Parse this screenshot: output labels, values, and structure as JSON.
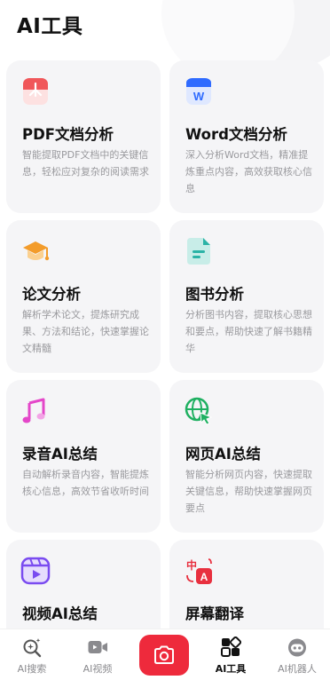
{
  "page": {
    "title": "AI工具"
  },
  "tools": [
    {
      "id": "pdf",
      "title": "PDF文档分析",
      "desc": "智能提取PDF文档中的关键信息，轻松应对复杂的阅读需求",
      "icon": "pdf-file-icon",
      "color": "#f0575a"
    },
    {
      "id": "word",
      "title": "Word文档分析",
      "desc": "深入分析Word文档，精准提炼重点内容，高效获取核心信息",
      "icon": "word-file-icon",
      "color": "#2f6bff"
    },
    {
      "id": "paper",
      "title": "论文分析",
      "desc": "解析学术论文，提炼研究成果、方法和结论，快速掌握论文精髓",
      "icon": "graduation-cap-icon",
      "color": "#f39c2b"
    },
    {
      "id": "book",
      "title": "图书分析",
      "desc": "分析图书内容，提取核心思想和要点，帮助快速了解书籍精华",
      "icon": "book-doc-icon",
      "color": "#2bb3a6"
    },
    {
      "id": "audio",
      "title": "录音AI总结",
      "desc": "自动解析录音内容，智能提炼核心信息，高效节省收听时间",
      "icon": "music-note-icon",
      "color": "#e447c9"
    },
    {
      "id": "web",
      "title": "网页AI总结",
      "desc": "智能分析网页内容，快速提取关键信息，帮助快速掌握网页要点",
      "icon": "globe-cursor-icon",
      "color": "#1fb061"
    },
    {
      "id": "video",
      "title": "视频AI总结",
      "desc": "",
      "icon": "video-play-icon",
      "color": "#7a4bf0"
    },
    {
      "id": "translate",
      "title": "屏幕翻译",
      "desc": "",
      "icon": "translate-icon",
      "color": "#e8303f"
    }
  ],
  "tabbar": {
    "tabs": [
      {
        "label": "AI搜索",
        "icon": "sparkle-search-icon"
      },
      {
        "label": "AI视频",
        "icon": "video-camera-icon"
      },
      {
        "label": "AI工具",
        "icon": "grid-tools-icon",
        "active": true
      },
      {
        "label": "AI机器人",
        "icon": "robot-icon"
      }
    ],
    "camera": {
      "icon": "camera-icon",
      "color": "#ee2a3c"
    }
  }
}
